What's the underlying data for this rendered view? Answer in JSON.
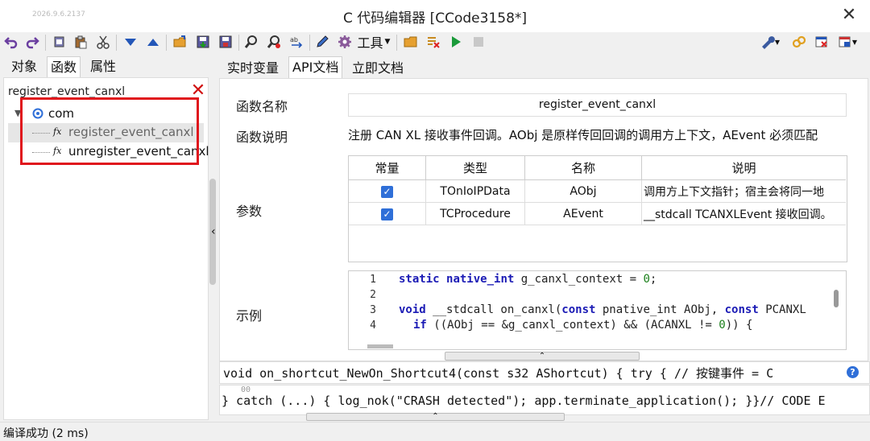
{
  "window": {
    "version": "2026.9.6.2137",
    "title": "C 代码编辑器 [CCode3158*]",
    "close": "✕"
  },
  "toolbar": {
    "tools_label": "工具",
    "icons": [
      "undo-icon",
      "redo-icon",
      "copy-icon",
      "paste-icon",
      "cut-icon",
      "move-down-icon",
      "move-up-icon",
      "open-folder-icon",
      "save-icon",
      "save-as-icon",
      "find-icon",
      "find-replace-icon",
      "replace-icon",
      "edit-icon",
      "gear-icon",
      "folder-icon",
      "clear-icon",
      "run-icon",
      "stop-icon",
      "wrench-icon",
      "link-icon",
      "close-doc-icon",
      "window-icon"
    ]
  },
  "left_tabs": [
    "对象",
    "函数",
    "属性"
  ],
  "right_tabs": [
    "实时变量",
    "API文档",
    "立即文档"
  ],
  "search": {
    "value": "register_event_canxl",
    "clear": "✕"
  },
  "tree": {
    "root": "com",
    "items": [
      "register_event_canxl",
      "unregister_event_canxl"
    ],
    "fx": "fx"
  },
  "doc": {
    "name_label": "函数名称",
    "name_value": "register_event_canxl",
    "desc_label": "函数说明",
    "desc_value": "注册 CAN XL 接收事件回调。AObj 是原样传回回调的调用方上下文，AEvent 必须匹配",
    "params_label": "参数",
    "example_label": "示例",
    "param_headers": [
      "常量",
      "类型",
      "名称",
      "说明"
    ],
    "params": [
      {
        "const": true,
        "type": "TOnIoIPData",
        "name": "AObj",
        "desc": "调用方上下文指针；宿主会将同一地"
      },
      {
        "const": true,
        "type": "TCProcedure",
        "name": "AEvent",
        "desc": "__stdcall TCANXLEvent 接收回调。"
      }
    ]
  },
  "code": {
    "line_numbers": [
      "1",
      "2",
      "3",
      "4"
    ],
    "l1_kw1": "static",
    "l1_kw2": "native_int",
    "l1_rest": " g_canxl_context = ",
    "l1_num": "0",
    "l1_end": ";",
    "l3_kw1": "void",
    "l3_mid": " __stdcall on_canxl(",
    "l3_kw2": "const",
    "l3_mid2": " pnative_int AObj, ",
    "l3_kw3": "const",
    "l3_end": " PCANXL",
    "l4_kw": "if",
    "l4_mid": " ((AObj == &g_canxl_context) && (ACANXL != ",
    "l4_num": "0",
    "l4_end": ")) {"
  },
  "shortcut": {
    "line1": "void on_shortcut_NewOn_Shortcut4(const s32 AShortcut) { try { // 按键事件 = C",
    "line2_ghost": "00",
    "line2": "} catch (...) { log_nok(\"CRASH detected\"); app.terminate_application(); }}// CODE E"
  },
  "status": {
    "text": "编译成功 (2 ms)"
  },
  "colors": {
    "highlight": "#e0161d",
    "accent": "#2f6fd8",
    "keyword": "#1b1bb5"
  }
}
